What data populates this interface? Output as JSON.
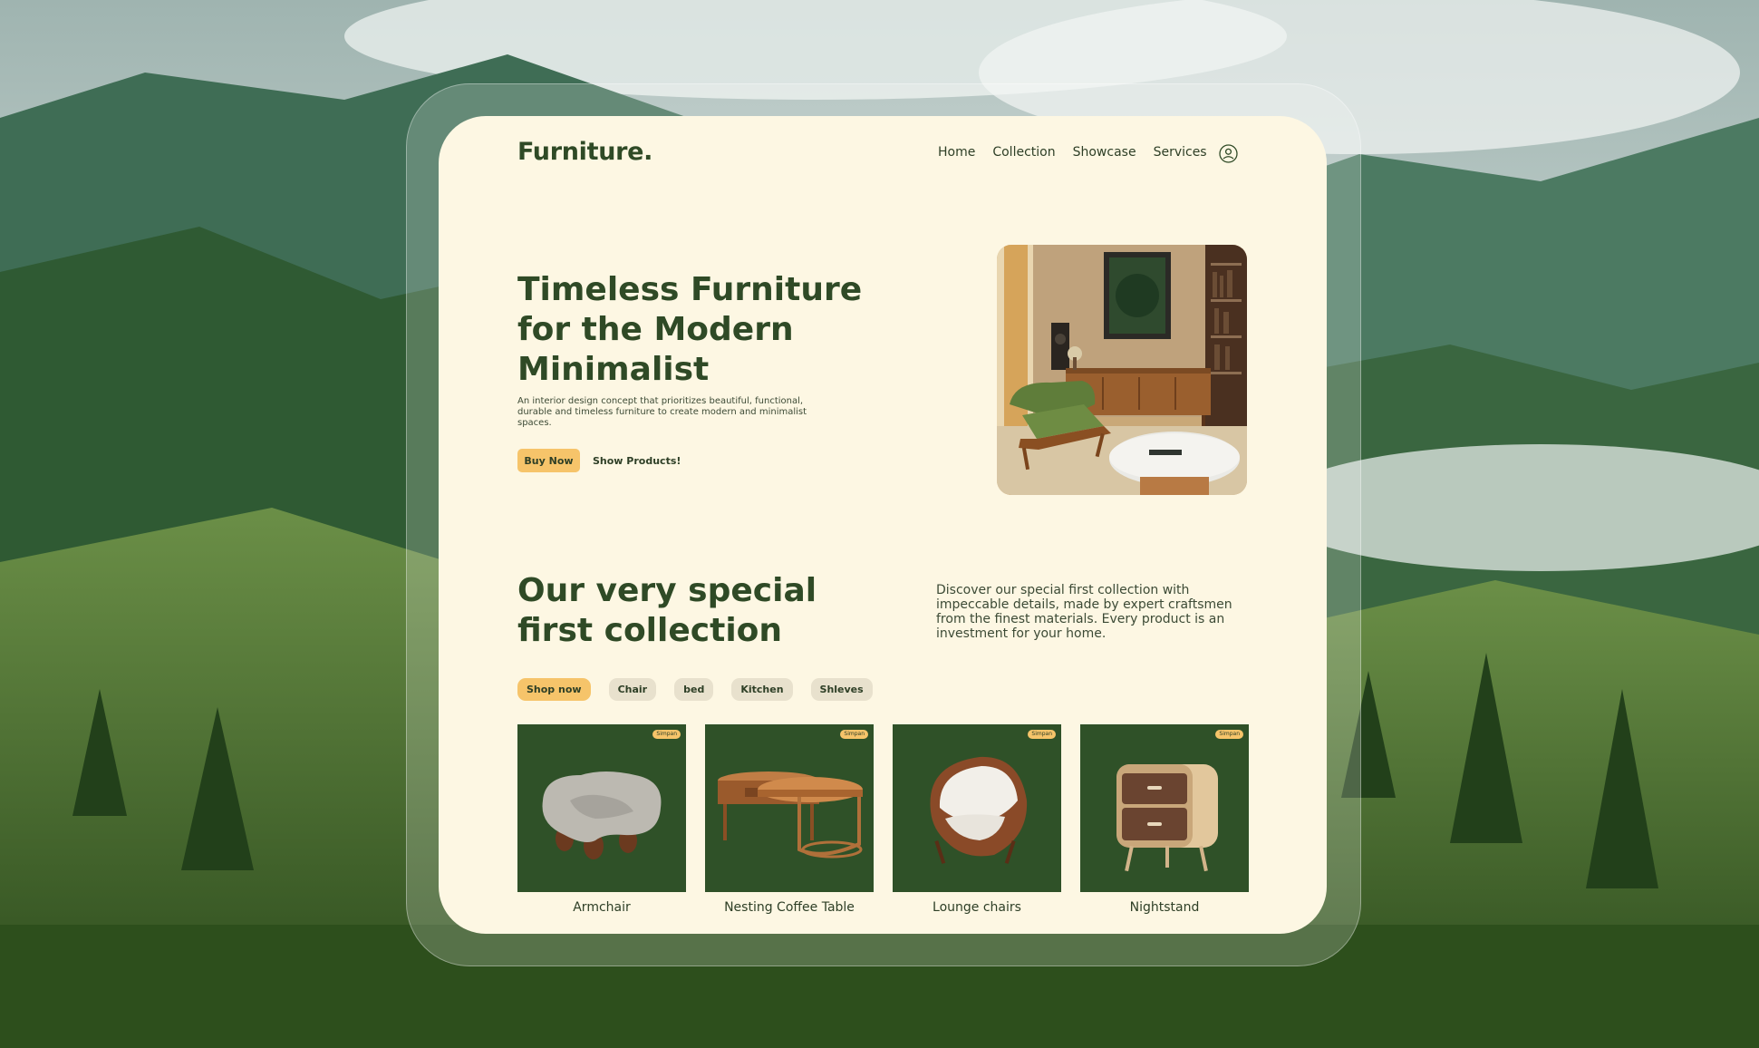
{
  "brand": {
    "logo": "Furniture."
  },
  "nav": {
    "items": [
      "Home",
      "Collection",
      "Showcase",
      "Services"
    ]
  },
  "icons": {
    "account": "user-circle-icon"
  },
  "hero": {
    "title": "Timeless Furniture for the Modern Minimalist",
    "description": "An interior design concept that prioritizes beautiful, functional, durable and timeless furniture to create modern and minimalist spaces.",
    "buy_label": "Buy Now",
    "show_label": "Show Products!"
  },
  "collection": {
    "title": "Our very special first collection",
    "description": "Discover our special first collection with impeccable details, made by expert craftsmen from the finest materials. Every product is an investment for your home.",
    "chips": [
      "Shop now",
      "Chair",
      "bed",
      "Kitchen",
      "Shleves"
    ],
    "active_chip": "Shop now"
  },
  "products": [
    {
      "name": "Armchair",
      "badge": "Simpan"
    },
    {
      "name": "Nesting Coffee Table",
      "badge": "Simpan"
    },
    {
      "name": "Lounge chairs",
      "badge": "Simpan"
    },
    {
      "name": "Nightstand",
      "badge": "Simpan"
    }
  ],
  "colors": {
    "card_bg": "#fdf7e3",
    "brand_green": "#2f4a26",
    "product_bg": "#2f5128",
    "accent": "#f6c46a",
    "chip_bg": "#e8e1cd"
  }
}
